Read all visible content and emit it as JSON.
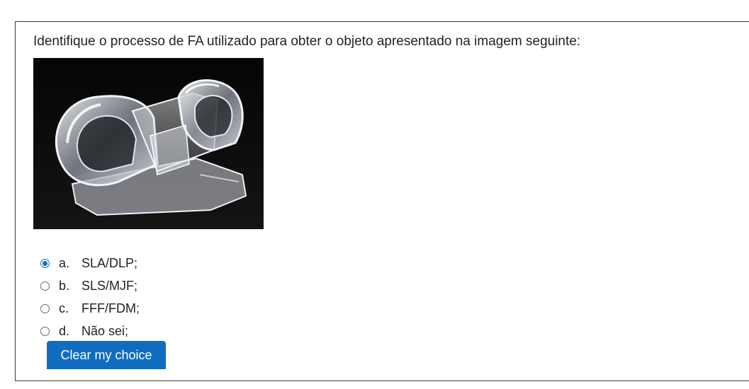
{
  "question": {
    "text": "Identifique o processo de FA utilizado para obter o objeto apresentado na imagem seguinte:"
  },
  "answers": [
    {
      "letter": "a.",
      "label": "SLA/DLP;",
      "selected": true
    },
    {
      "letter": "b.",
      "label": "SLS/MJF;",
      "selected": false
    },
    {
      "letter": "c.",
      "label": "FFF/FDM;",
      "selected": false
    },
    {
      "letter": "d.",
      "label": "Não sei;",
      "selected": false
    }
  ],
  "clear_button": {
    "label": "Clear my choice"
  },
  "colors": {
    "accent": "#0f6cbf",
    "text": "#1d2125",
    "border": "#3a3a3a",
    "photo_background": "#000000"
  }
}
